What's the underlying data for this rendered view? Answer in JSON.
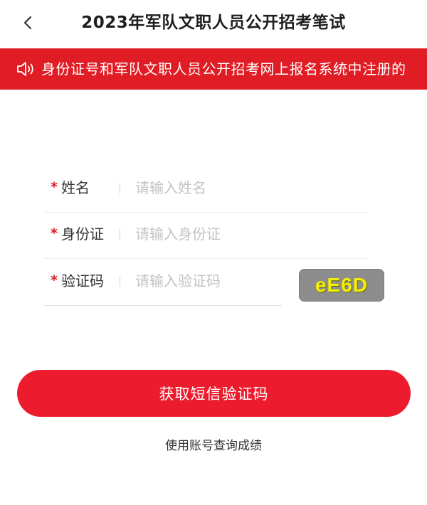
{
  "header": {
    "title": "2023年军队文职人员公开招考笔试",
    "back_icon": "chevron-left-icon"
  },
  "notice": {
    "icon": "speaker-icon",
    "text": "身份证号和军队文职人员公开招考网上报名系统中注册的",
    "background": "#e01c24"
  },
  "form": {
    "name": {
      "required_mark": "*",
      "label": "姓名",
      "placeholder": "请输入姓名",
      "value": ""
    },
    "id_card": {
      "required_mark": "*",
      "label": "身份证",
      "placeholder": "请输入身份证",
      "value": ""
    },
    "captcha": {
      "required_mark": "*",
      "label": "验证码",
      "placeholder": "请输入验证码",
      "value": "",
      "image_text": "eE6D"
    }
  },
  "actions": {
    "primary_label": "获取短信验证码",
    "primary_color": "#ec1c2e",
    "account_link": "使用账号查询成绩"
  }
}
